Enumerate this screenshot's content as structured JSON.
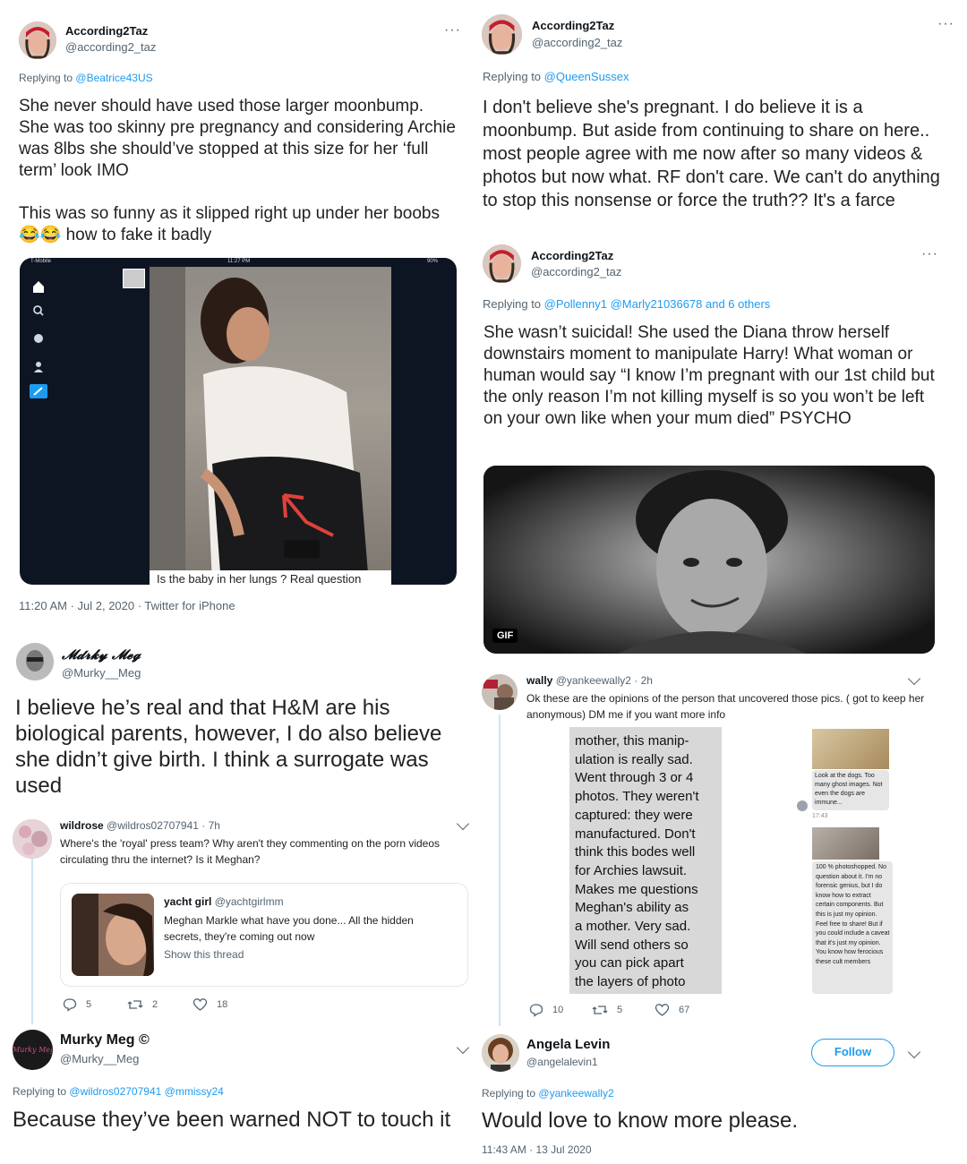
{
  "tweet1": {
    "name": "According2Taz",
    "handle": "@according2_taz",
    "more": "···",
    "replying_prefix": "Replying to",
    "replying_to": "@Beatrice43US",
    "text": "She never should have used those larger moonbump. She was too skinny pre pregnancy and considering Archie was 8lbs she should’ve stopped at this size for her ‘full term’ look IMO\n\nThis was so funny as it slipped right up under her boobs 😂😂 how to fake it badly",
    "image_statusbar": {
      "carrier": "T-Mobile",
      "time": "11:27 PM",
      "battery": "90%"
    },
    "image_caption": "Is the baby in her lungs ? Real question",
    "timestamp": "11:20 AM · Jul 2, 2020 · Twitter for iPhone"
  },
  "tweet2": {
    "name": "According2Taz",
    "handle": "@according2_taz",
    "more": "···",
    "replying_prefix": "Replying to",
    "replying_to": "@QueenSussex",
    "text": "I don't believe she's pregnant. I do believe it is a moonbump. But aside from continuing to share on here.. most people agree with me now after so many videos & photos but now what. RF don't care. We can't do anything to stop this nonsense or force the truth?? It's a farce"
  },
  "tweet3": {
    "name": "According2Taz",
    "handle": "@according2_taz",
    "more": "···",
    "replying_prefix": "Replying to",
    "replying_to": "@Pollenny1 @Marly21036678 and 6 others",
    "text": "She wasn’t suicidal! She used the Diana throw herself downstairs moment to manipulate Harry! What woman or human would say “I know I’m pregnant with our 1st child but the only reason I’m not killing myself is so you won’t be left on your own like when your mum died” PSYCHO",
    "gif_badge": "GIF"
  },
  "tweet4": {
    "name": "𝓜𝓭𝓻𝓴𝔂 𝓜𝓮𝓰",
    "handle": "@Murky__Meg",
    "text": "I believe he’s real and that H&M are his biological parents, however, I do also believe she didn’t give birth. I think a surrogate was used"
  },
  "tweet5": {
    "name": "wildrose",
    "handle": "@wildros02707941",
    "time": "· 7h",
    "text": "Where's the 'royal' press team? Why aren't they commenting on the porn videos circulating thru the internet? Is it Meghan?",
    "quote": {
      "name": "yacht girl",
      "handle": "@yachtgirlmm",
      "text": "Meghan Markle what have you done... All the hidden secrets, they're coming out now",
      "link": "Show this thread"
    },
    "replies": "5",
    "retweets": "2",
    "likes": "18"
  },
  "tweet6": {
    "name": "Murky Meg ©",
    "handle": "@Murky__Meg",
    "avatar_text": "Murky Meg",
    "replying_prefix": "Replying to",
    "replying_to": "@wildros02707941 @mmissy24",
    "text": "Because they’ve been warned NOT to touch it"
  },
  "tweet7": {
    "name": "wally",
    "handle": "@yankeewally2",
    "time": "· 2h",
    "text": "Ok these are the opinions of the person that uncovered those pics. ( got to keep her anonymous) DM me if you want more info",
    "left_image_text": "mother, this manip-\nulation is really sad.\nWent through 3 or 4\nphotos. They weren't\ncaptured: they were\nmanufactured. Don't\nthink this bodes well\nfor Archies lawsuit.\nMakes me questions\nMeghan's ability as\na mother. Very sad.\nWill send others so\nyou can pick apart\nthe layers of photo",
    "right_msg1": "Look at the dogs. Too many ghost images. Not even the dogs are immune...",
    "right_msg_time": "17:43",
    "right_msg2": "100 % photoshopped. No question about it. I'm no forensic genius, but I do know how to extract certain components. But this is just my opinion. Feel free to share! But if you could include a caveat that it's just my opinion. You know how ferocious these cult members",
    "replies": "10",
    "retweets": "5",
    "likes": "67"
  },
  "tweet8": {
    "name": "Angela Levin",
    "handle": "@angelalevin1",
    "follow_label": "Follow",
    "replying_prefix": "Replying to",
    "replying_to": "@yankeewally2",
    "text": "Would love to know more please.",
    "timestamp": "11:43 AM · 13 Jul 2020"
  },
  "colors": {
    "link": "#1d9bf0",
    "text": "#0f1419",
    "muted": "#536471"
  }
}
